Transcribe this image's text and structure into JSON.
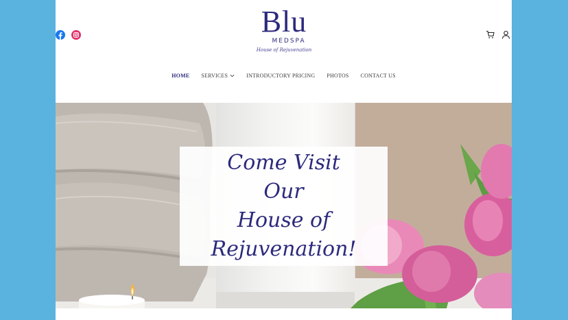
{
  "site": {
    "logo_main": "Blu",
    "logo_sub": "MEDSPA",
    "logo_tagline": "House of Rejuvenation"
  },
  "social": [
    {
      "icon": "facebook-icon",
      "color": "#1877f2"
    },
    {
      "icon": "instagram-icon",
      "color": "#e1306c"
    }
  ],
  "tools": [
    {
      "icon": "cart-icon"
    },
    {
      "icon": "account-icon"
    }
  ],
  "nav": {
    "items": [
      {
        "label": "HOME",
        "active": true
      },
      {
        "label": "SERVICES",
        "has_dropdown": true
      },
      {
        "label": "INTRODUCTORY PRICING"
      },
      {
        "label": "PHOTOS"
      },
      {
        "label": "CONTACT US"
      }
    ]
  },
  "hero": {
    "line1": "Come Visit Our",
    "line2": "House of",
    "line3": "Rejuvenation!"
  },
  "colors": {
    "brand": "#2c2a7c",
    "outer_background": "#5ab3df"
  }
}
